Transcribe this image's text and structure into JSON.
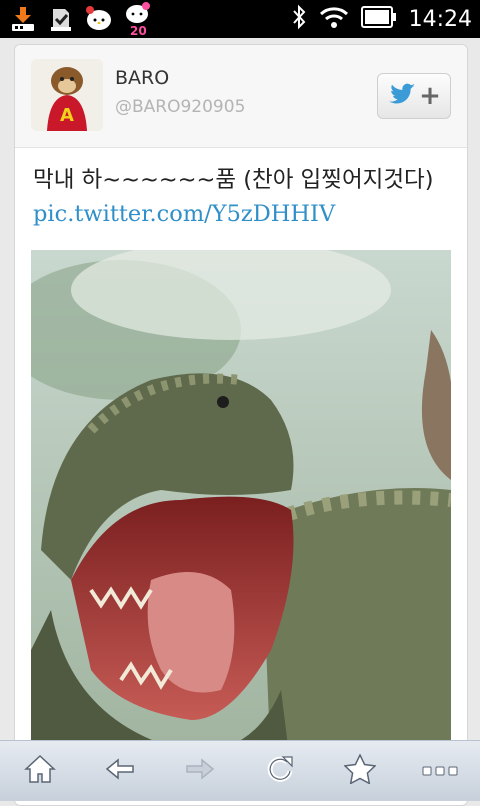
{
  "status_bar": {
    "time": "14:24",
    "notification_icons": [
      "download-icon",
      "sd-card-icon",
      "hello-kitty-icon",
      "hello-kitty-20-icon"
    ],
    "system_icons": [
      "bluetooth-icon",
      "wifi-icon",
      "battery-icon"
    ]
  },
  "profile": {
    "name": "BARO",
    "handle": "@BARO920905",
    "follow_button_icon": "twitter-bird-icon",
    "follow_button_plus": "+"
  },
  "tweet": {
    "text": "막내 하~~~~~~품 (찬아 입찢어지것다) ",
    "link": "pic.twitter.com/Y5zDHHIV"
  },
  "toolbar": {
    "buttons": [
      "home-icon",
      "back-icon",
      "forward-icon",
      "refresh-icon",
      "star-icon",
      "more-icon"
    ]
  },
  "colors": {
    "link": "#2f8fc9",
    "status_bar": "#000000",
    "toolbar_top": "#e6ebf1",
    "toolbar_bottom": "#c7d0db"
  }
}
